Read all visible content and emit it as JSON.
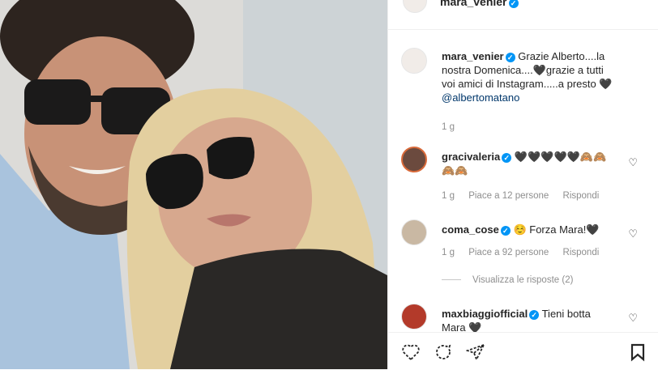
{
  "post": {
    "username": "mara_venier",
    "caption": "Grazie Alberto....la nostra Domenica....🖤grazie a tutti voi amici di Instagram.....a presto 🖤",
    "mention": "@albertomatano",
    "time": "1 g"
  },
  "comments": [
    {
      "username": "gracivaleria",
      "text": "🖤🖤🖤🖤🖤🙈🙈🙈🙈",
      "time": "1 g",
      "likes": "Piace a 12 persone",
      "reply": "Rispondi"
    },
    {
      "username": "coma_cose",
      "text": "☺️ Forza Mara!🖤",
      "time": "1 g",
      "likes": "Piace a 92 persone",
      "reply": "Rispondi",
      "view_replies": "Visualizza le risposte (2)"
    },
    {
      "username": "maxbiaggiofficial",
      "text": "Tieni botta Mara 🖤"
    }
  ],
  "icons": {
    "verified": "verified-badge-icon",
    "like": "heart-outline-icon",
    "comment": "comment-icon",
    "share": "send-icon",
    "save": "bookmark-icon"
  },
  "colors": {
    "verified": "#0095f6",
    "meta_text": "#8e8e8e",
    "mention": "#00376b"
  }
}
